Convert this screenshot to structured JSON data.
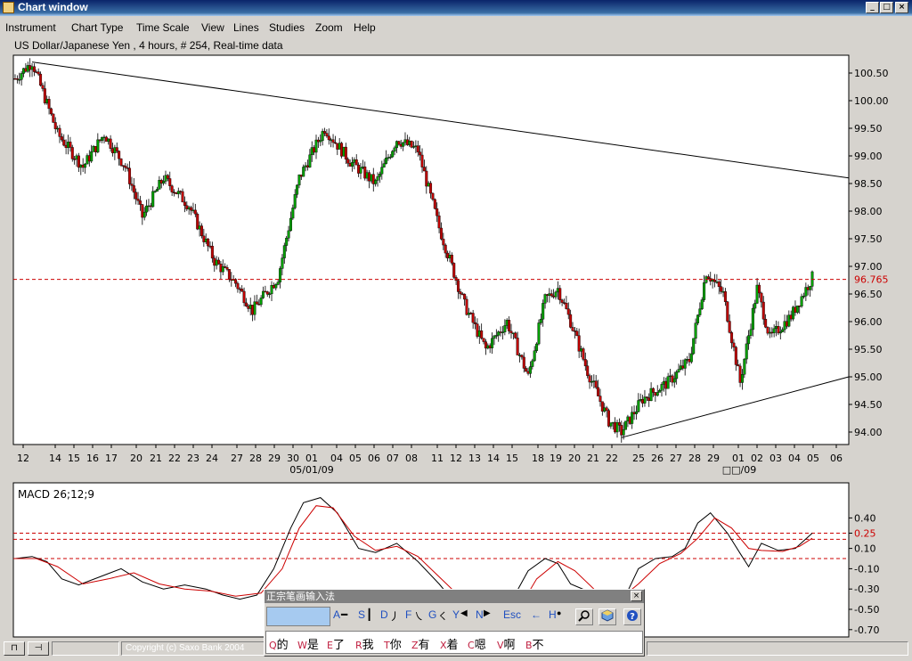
{
  "window": {
    "title": "Chart window"
  },
  "menu": [
    "Instrument",
    "Chart Type",
    "Time Scale",
    "View",
    "Lines",
    "Studies",
    "Zoom",
    "Help"
  ],
  "chart": {
    "heading": "US Dollar/Japanese Yen , 4 hours, # 254, Real-time data",
    "current_price": "96.765",
    "price_ticks": [
      "100.50",
      "100.00",
      "99.50",
      "99.00",
      "98.50",
      "98.00",
      "97.50",
      "97.00",
      "96.50",
      "96.00",
      "95.50",
      "95.00",
      "94.50",
      "94.00"
    ],
    "date_ticks": [
      "12",
      "14",
      "15",
      "16",
      "17",
      "20",
      "21",
      "22",
      "23",
      "24",
      "27",
      "28",
      "29",
      "30",
      "01",
      "04",
      "05",
      "06",
      "07",
      "08",
      "11",
      "12",
      "13",
      "14",
      "15",
      "18",
      "19",
      "20",
      "21",
      "22",
      "25",
      "26",
      "27",
      "28",
      "29",
      "01",
      "02",
      "03",
      "04",
      "05",
      "06"
    ],
    "month_labels": [
      "05/01/09",
      "□□/09"
    ]
  },
  "macd": {
    "label": "MACD 26;12;9",
    "ticks": [
      "0.40",
      "0.25",
      "0.10",
      "-0.10",
      "-0.30",
      "-0.50",
      "-0.70"
    ]
  },
  "chart_data": [
    {
      "type": "candlestick",
      "title": "US Dollar/Japanese Yen , 4 hours, # 254, Real-time data",
      "ylim": [
        93.8,
        100.8
      ],
      "x_tick_labels": [
        "12",
        "14",
        "15",
        "16",
        "17",
        "20",
        "21",
        "22",
        "23",
        "24",
        "27",
        "28",
        "29",
        "30",
        "01",
        "04",
        "05",
        "06",
        "07",
        "08",
        "11",
        "12",
        "13",
        "14",
        "15",
        "18",
        "19",
        "20",
        "21",
        "22",
        "25",
        "26",
        "27",
        "28",
        "29",
        "01",
        "02",
        "03",
        "04",
        "05",
        "06"
      ],
      "close_path": [
        [
          0,
          100.4
        ],
        [
          8,
          100.7
        ],
        [
          20,
          99.4
        ],
        [
          32,
          98.8
        ],
        [
          42,
          99.4
        ],
        [
          52,
          98.8
        ],
        [
          60,
          97.9
        ],
        [
          70,
          98.6
        ],
        [
          82,
          98.1
        ],
        [
          94,
          97.1
        ],
        [
          104,
          96.7
        ],
        [
          112,
          96.2
        ],
        [
          124,
          96.8
        ],
        [
          134,
          98.6
        ],
        [
          146,
          99.5
        ],
        [
          158,
          98.9
        ],
        [
          170,
          98.5
        ],
        [
          180,
          99.3
        ],
        [
          190,
          99.1
        ],
        [
          200,
          97.7
        ],
        [
          212,
          96.3
        ],
        [
          222,
          95.5
        ],
        [
          232,
          96.0
        ],
        [
          242,
          95.0
        ],
        [
          250,
          96.4
        ],
        [
          256,
          96.6
        ],
        [
          262,
          96.0
        ],
        [
          270,
          95.1
        ],
        [
          280,
          94.2
        ],
        [
          286,
          94.0
        ],
        [
          296,
          94.6
        ],
        [
          308,
          94.9
        ],
        [
          318,
          95.3
        ],
        [
          326,
          96.9
        ],
        [
          334,
          96.5
        ],
        [
          342,
          94.9
        ],
        [
          350,
          96.6
        ],
        [
          356,
          95.7
        ],
        [
          366,
          96.1
        ],
        [
          376,
          96.8
        ]
      ],
      "horizontal_line": 96.765,
      "trendlines": [
        {
          "name": "resistance",
          "from": [
            8,
            100.7
          ],
          "to": [
            376,
            98.6
          ]
        },
        {
          "name": "support",
          "from": [
            286,
            93.9
          ],
          "to": [
            376,
            95.0
          ]
        }
      ]
    },
    {
      "type": "line",
      "title": "MACD 26;12;9",
      "ylim": [
        -0.8,
        0.5
      ],
      "reference_levels": [
        0.25,
        0.19,
        0.0
      ],
      "series": [
        {
          "color": "#000000",
          "values": [
            [
              0,
              0.0
            ],
            [
              8,
              0.02
            ],
            [
              15,
              -0.03
            ],
            [
              22,
              -0.2
            ],
            [
              30,
              -0.26
            ],
            [
              40,
              -0.18
            ],
            [
              50,
              -0.1
            ],
            [
              60,
              -0.23
            ],
            [
              70,
              -0.3
            ],
            [
              80,
              -0.26
            ],
            [
              90,
              -0.3
            ],
            [
              98,
              -0.36
            ],
            [
              106,
              -0.4
            ],
            [
              114,
              -0.36
            ],
            [
              122,
              -0.1
            ],
            [
              130,
              0.3
            ],
            [
              136,
              0.55
            ],
            [
              144,
              0.6
            ],
            [
              152,
              0.45
            ],
            [
              162,
              0.1
            ],
            [
              170,
              0.06
            ],
            [
              180,
              0.15
            ],
            [
              190,
              -0.03
            ],
            [
              200,
              -0.25
            ],
            [
              210,
              -0.5
            ],
            [
              222,
              -0.65
            ],
            [
              232,
              -0.5
            ],
            [
              242,
              -0.12
            ],
            [
              250,
              0.0
            ],
            [
              256,
              -0.05
            ],
            [
              262,
              -0.25
            ],
            [
              270,
              -0.32
            ],
            [
              278,
              -0.4
            ],
            [
              286,
              -0.45
            ],
            [
              294,
              -0.1
            ],
            [
              302,
              0.0
            ],
            [
              310,
              0.02
            ],
            [
              316,
              0.1
            ],
            [
              322,
              0.35
            ],
            [
              328,
              0.45
            ],
            [
              336,
              0.25
            ],
            [
              342,
              0.05
            ],
            [
              346,
              -0.08
            ],
            [
              352,
              0.15
            ],
            [
              360,
              0.08
            ],
            [
              368,
              0.1
            ],
            [
              376,
              0.25
            ]
          ]
        },
        {
          "color": "#cc0000",
          "values": [
            [
              0,
              0.0
            ],
            [
              10,
              0.0
            ],
            [
              20,
              -0.08
            ],
            [
              32,
              -0.25
            ],
            [
              44,
              -0.2
            ],
            [
              56,
              -0.14
            ],
            [
              68,
              -0.25
            ],
            [
              80,
              -0.3
            ],
            [
              92,
              -0.32
            ],
            [
              104,
              -0.37
            ],
            [
              116,
              -0.34
            ],
            [
              126,
              -0.1
            ],
            [
              134,
              0.3
            ],
            [
              142,
              0.52
            ],
            [
              150,
              0.5
            ],
            [
              160,
              0.22
            ],
            [
              170,
              0.08
            ],
            [
              180,
              0.12
            ],
            [
              190,
              0.02
            ],
            [
              200,
              -0.18
            ],
            [
              212,
              -0.42
            ],
            [
              224,
              -0.58
            ],
            [
              236,
              -0.55
            ],
            [
              246,
              -0.2
            ],
            [
              256,
              -0.03
            ],
            [
              264,
              -0.12
            ],
            [
              274,
              -0.32
            ],
            [
              284,
              -0.42
            ],
            [
              294,
              -0.25
            ],
            [
              304,
              -0.05
            ],
            [
              314,
              0.05
            ],
            [
              322,
              0.2
            ],
            [
              330,
              0.4
            ],
            [
              338,
              0.3
            ],
            [
              346,
              0.1
            ],
            [
              352,
              0.08
            ],
            [
              362,
              0.07
            ],
            [
              370,
              0.12
            ],
            [
              376,
              0.2
            ]
          ]
        }
      ]
    }
  ],
  "ime": {
    "title": "正宗笔画输入法",
    "close": "×",
    "keys": [
      "A",
      "S",
      "D",
      "F",
      "G",
      "Y",
      "N",
      "Esc",
      "←",
      "H"
    ],
    "strokes": [
      "━",
      "┃",
      "丿",
      "㇏",
      "㇛",
      "◀",
      "▶",
      "",
      "",
      "●"
    ],
    "candidates": [
      {
        "key": "Q",
        "char": "的"
      },
      {
        "key": "W",
        "char": "是"
      },
      {
        "key": "E",
        "char": "了"
      },
      {
        "key": "R",
        "char": "我"
      },
      {
        "key": "T",
        "char": "你"
      },
      {
        "key": "Z",
        "char": "有"
      },
      {
        "key": "X",
        "char": "着"
      },
      {
        "key": "C",
        "char": "嗯"
      },
      {
        "key": "V",
        "char": "啊"
      },
      {
        "key": "B",
        "char": "不"
      }
    ]
  },
  "status": {
    "copyright": "Copyright (c) Saxo Bank 2004",
    "btn1": "⊓",
    "btn2": "⊣"
  }
}
